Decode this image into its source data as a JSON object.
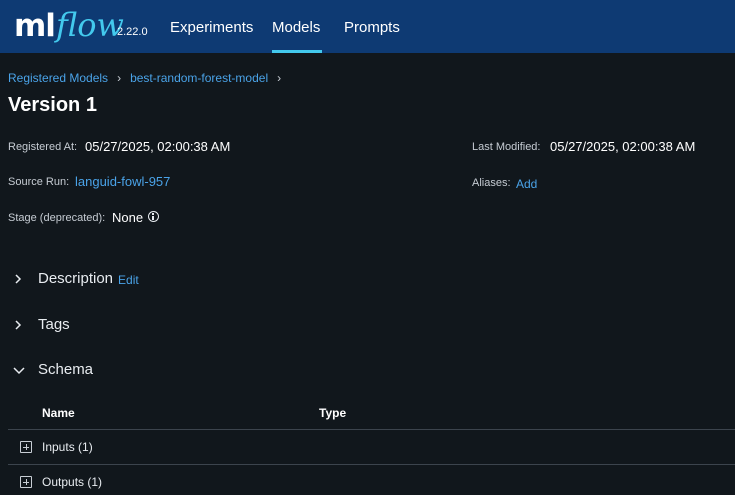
{
  "header": {
    "logo_ml": "ml",
    "logo_flow": "flow",
    "version": "2.22.0",
    "nav": [
      "Experiments",
      "Models",
      "Prompts"
    ],
    "active_nav": "Models",
    "accent_color": "#43c9ed",
    "bar_color": "#0e3a73"
  },
  "breadcrumb": {
    "items": [
      "Registered Models",
      "best-random-forest-model"
    ],
    "separator": "›"
  },
  "page_title": "Version 1",
  "meta": {
    "registered_at_label": "Registered At:",
    "registered_at_value": "05/27/2025, 02:00:38 AM",
    "last_modified_label": "Last Modified:",
    "last_modified_value": "05/27/2025, 02:00:38 AM",
    "source_run_label": "Source Run:",
    "source_run_value": "languid-fowl-957",
    "aliases_label": "Aliases:",
    "aliases_add": "Add",
    "stage_label": "Stage (deprecated):",
    "stage_value": "None",
    "stage_icon": "info-icon"
  },
  "sections": {
    "description": {
      "title": "Description",
      "edit": "Edit",
      "expanded": false
    },
    "tags": {
      "title": "Tags",
      "expanded": false
    },
    "schema": {
      "title": "Schema",
      "expanded": true
    }
  },
  "schema_table": {
    "columns": [
      "Name",
      "Type"
    ],
    "rows": [
      "Inputs (1)",
      "Outputs (1)"
    ]
  },
  "colors": {
    "background": "#11171c",
    "link": "#4aa3e8"
  }
}
